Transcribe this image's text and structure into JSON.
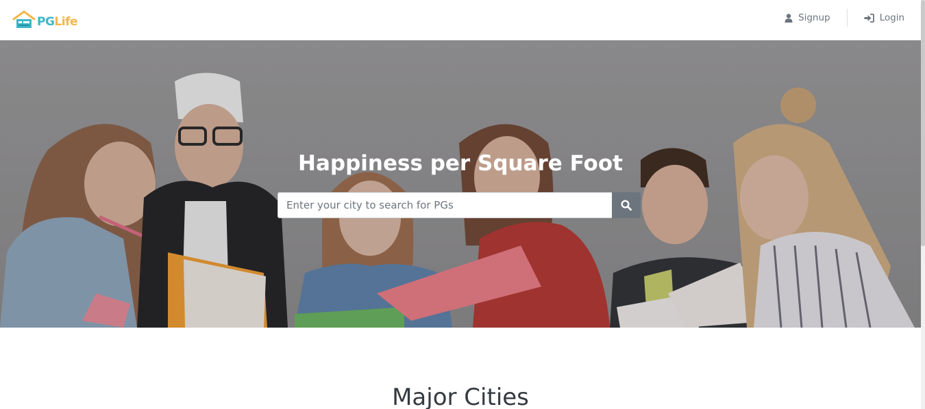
{
  "brand": {
    "pg": "PG",
    "life": "Life",
    "colors": {
      "pg": "#3cb7c9",
      "life": "#f4b64a"
    }
  },
  "nav": {
    "signup_label": "Signup",
    "login_label": "Login",
    "signup_icon": "user-icon",
    "login_icon": "sign-in-icon"
  },
  "hero": {
    "title": "Happiness per Square Foot",
    "search_placeholder": "Enter your city to search for PGs",
    "search_value": "",
    "search_icon": "search-icon",
    "search_button_color": "#6c757d"
  },
  "sections": {
    "major_cities_title": "Major Cities"
  }
}
